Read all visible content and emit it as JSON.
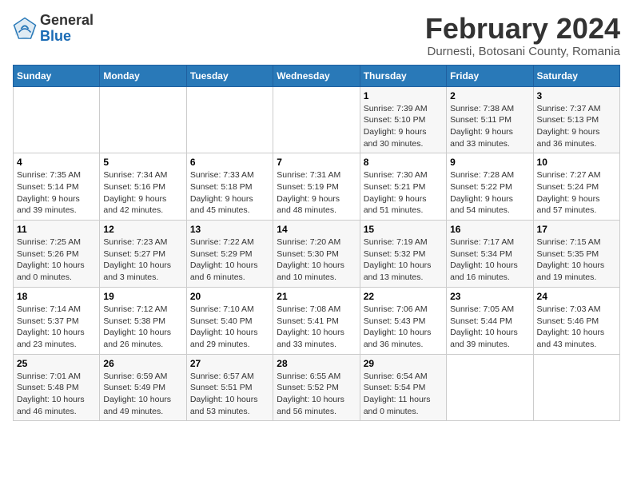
{
  "header": {
    "logo_general": "General",
    "logo_blue": "Blue",
    "month_year": "February 2024",
    "location": "Durnesti, Botosani County, Romania"
  },
  "days_of_week": [
    "Sunday",
    "Monday",
    "Tuesday",
    "Wednesday",
    "Thursday",
    "Friday",
    "Saturday"
  ],
  "weeks": [
    [
      {
        "day": "",
        "info": ""
      },
      {
        "day": "",
        "info": ""
      },
      {
        "day": "",
        "info": ""
      },
      {
        "day": "",
        "info": ""
      },
      {
        "day": "1",
        "info": "Sunrise: 7:39 AM\nSunset: 5:10 PM\nDaylight: 9 hours\nand 30 minutes."
      },
      {
        "day": "2",
        "info": "Sunrise: 7:38 AM\nSunset: 5:11 PM\nDaylight: 9 hours\nand 33 minutes."
      },
      {
        "day": "3",
        "info": "Sunrise: 7:37 AM\nSunset: 5:13 PM\nDaylight: 9 hours\nand 36 minutes."
      }
    ],
    [
      {
        "day": "4",
        "info": "Sunrise: 7:35 AM\nSunset: 5:14 PM\nDaylight: 9 hours\nand 39 minutes."
      },
      {
        "day": "5",
        "info": "Sunrise: 7:34 AM\nSunset: 5:16 PM\nDaylight: 9 hours\nand 42 minutes."
      },
      {
        "day": "6",
        "info": "Sunrise: 7:33 AM\nSunset: 5:18 PM\nDaylight: 9 hours\nand 45 minutes."
      },
      {
        "day": "7",
        "info": "Sunrise: 7:31 AM\nSunset: 5:19 PM\nDaylight: 9 hours\nand 48 minutes."
      },
      {
        "day": "8",
        "info": "Sunrise: 7:30 AM\nSunset: 5:21 PM\nDaylight: 9 hours\nand 51 minutes."
      },
      {
        "day": "9",
        "info": "Sunrise: 7:28 AM\nSunset: 5:22 PM\nDaylight: 9 hours\nand 54 minutes."
      },
      {
        "day": "10",
        "info": "Sunrise: 7:27 AM\nSunset: 5:24 PM\nDaylight: 9 hours\nand 57 minutes."
      }
    ],
    [
      {
        "day": "11",
        "info": "Sunrise: 7:25 AM\nSunset: 5:26 PM\nDaylight: 10 hours\nand 0 minutes."
      },
      {
        "day": "12",
        "info": "Sunrise: 7:23 AM\nSunset: 5:27 PM\nDaylight: 10 hours\nand 3 minutes."
      },
      {
        "day": "13",
        "info": "Sunrise: 7:22 AM\nSunset: 5:29 PM\nDaylight: 10 hours\nand 6 minutes."
      },
      {
        "day": "14",
        "info": "Sunrise: 7:20 AM\nSunset: 5:30 PM\nDaylight: 10 hours\nand 10 minutes."
      },
      {
        "day": "15",
        "info": "Sunrise: 7:19 AM\nSunset: 5:32 PM\nDaylight: 10 hours\nand 13 minutes."
      },
      {
        "day": "16",
        "info": "Sunrise: 7:17 AM\nSunset: 5:34 PM\nDaylight: 10 hours\nand 16 minutes."
      },
      {
        "day": "17",
        "info": "Sunrise: 7:15 AM\nSunset: 5:35 PM\nDaylight: 10 hours\nand 19 minutes."
      }
    ],
    [
      {
        "day": "18",
        "info": "Sunrise: 7:14 AM\nSunset: 5:37 PM\nDaylight: 10 hours\nand 23 minutes."
      },
      {
        "day": "19",
        "info": "Sunrise: 7:12 AM\nSunset: 5:38 PM\nDaylight: 10 hours\nand 26 minutes."
      },
      {
        "day": "20",
        "info": "Sunrise: 7:10 AM\nSunset: 5:40 PM\nDaylight: 10 hours\nand 29 minutes."
      },
      {
        "day": "21",
        "info": "Sunrise: 7:08 AM\nSunset: 5:41 PM\nDaylight: 10 hours\nand 33 minutes."
      },
      {
        "day": "22",
        "info": "Sunrise: 7:06 AM\nSunset: 5:43 PM\nDaylight: 10 hours\nand 36 minutes."
      },
      {
        "day": "23",
        "info": "Sunrise: 7:05 AM\nSunset: 5:44 PM\nDaylight: 10 hours\nand 39 minutes."
      },
      {
        "day": "24",
        "info": "Sunrise: 7:03 AM\nSunset: 5:46 PM\nDaylight: 10 hours\nand 43 minutes."
      }
    ],
    [
      {
        "day": "25",
        "info": "Sunrise: 7:01 AM\nSunset: 5:48 PM\nDaylight: 10 hours\nand 46 minutes."
      },
      {
        "day": "26",
        "info": "Sunrise: 6:59 AM\nSunset: 5:49 PM\nDaylight: 10 hours\nand 49 minutes."
      },
      {
        "day": "27",
        "info": "Sunrise: 6:57 AM\nSunset: 5:51 PM\nDaylight: 10 hours\nand 53 minutes."
      },
      {
        "day": "28",
        "info": "Sunrise: 6:55 AM\nSunset: 5:52 PM\nDaylight: 10 hours\nand 56 minutes."
      },
      {
        "day": "29",
        "info": "Sunrise: 6:54 AM\nSunset: 5:54 PM\nDaylight: 11 hours\nand 0 minutes."
      },
      {
        "day": "",
        "info": ""
      },
      {
        "day": "",
        "info": ""
      }
    ]
  ]
}
